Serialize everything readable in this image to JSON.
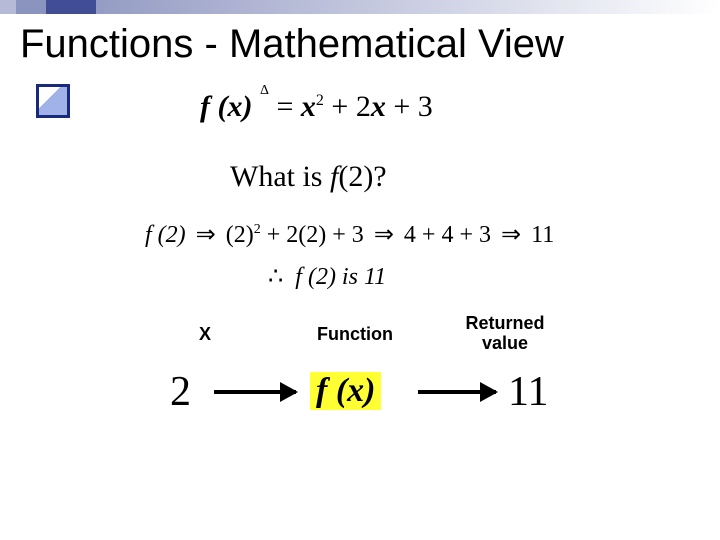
{
  "title": "Functions - Mathematical View",
  "definition": {
    "lhs": "f (x)",
    "delta": "Δ",
    "rhs": "x² + 2x + 3"
  },
  "question": "What is f(2)?",
  "evaluation": {
    "lhs": "f (2)",
    "step1": "(2)² + 2(2) + 3",
    "step2": "4 + 4 + 3",
    "result": "11"
  },
  "conclusion": {
    "therefore": "∴",
    "text": "f (2) is 11"
  },
  "labels": {
    "x": "X",
    "fn": "Function",
    "ret_line1": "Returned",
    "ret_line2": "value"
  },
  "flow": {
    "input": "2",
    "box": "f (x)",
    "output": "11"
  }
}
